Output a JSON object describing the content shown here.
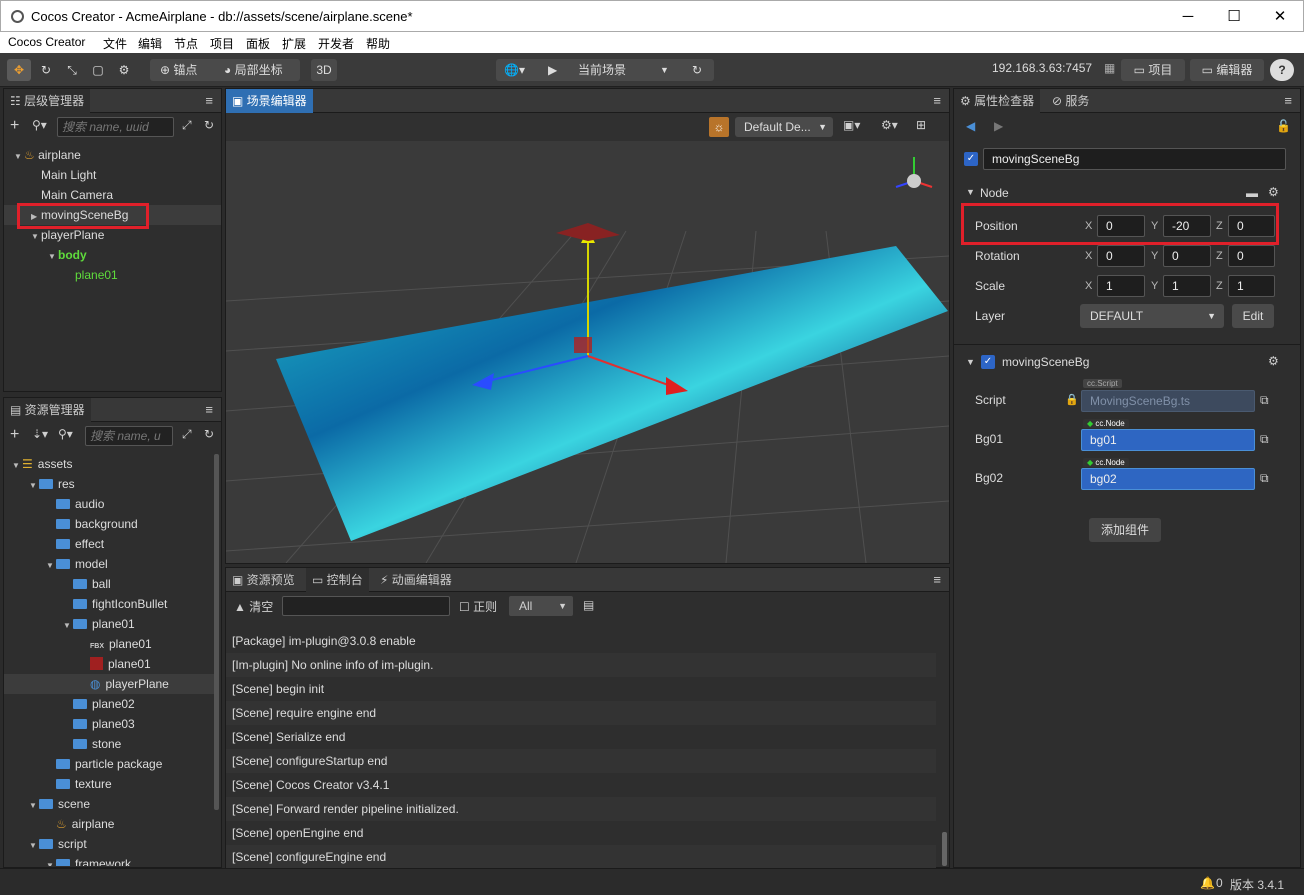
{
  "window": {
    "title": "Cocos Creator - AcmeAirplane - db://assets/scene/airplane.scene*",
    "minimize": "─",
    "maximize": "☐",
    "close": "✕"
  },
  "menu": [
    "Cocos Creator",
    "文件",
    "编辑",
    "节点",
    "项目",
    "面板",
    "扩展",
    "开发者",
    "帮助"
  ],
  "toolbar": {
    "anchor": "锚点",
    "local": "局部坐标",
    "mode3d": "3D",
    "scene_select": "当前场景",
    "ip": "192.168.3.63:7457",
    "project": "项目",
    "editor": "编辑器",
    "help": "?"
  },
  "hierarchy": {
    "tab": "层级管理器",
    "search_placeholder": "搜索 name, uuid",
    "nodes": [
      {
        "label": "airplane",
        "level": 0,
        "expanded": true,
        "icon": "scene"
      },
      {
        "label": "Main Light",
        "level": 1
      },
      {
        "label": "Main Camera",
        "level": 1
      },
      {
        "label": "movingSceneBg",
        "level": 1,
        "collapsed": true,
        "selected": true
      },
      {
        "label": "playerPlane",
        "level": 1,
        "expanded": true
      },
      {
        "label": "body",
        "level": 2,
        "expanded": true,
        "green": true
      },
      {
        "label": "plane01",
        "level": 3,
        "green": true
      }
    ]
  },
  "assets": {
    "tab": "资源管理器",
    "search_placeholder": "搜索 name, u",
    "items": [
      {
        "label": "assets",
        "level": 0,
        "expanded": true,
        "icon": "db"
      },
      {
        "label": "res",
        "level": 1,
        "expanded": true
      },
      {
        "label": "audio",
        "level": 2
      },
      {
        "label": "background",
        "level": 2
      },
      {
        "label": "effect",
        "level": 2
      },
      {
        "label": "model",
        "level": 2,
        "expanded": true
      },
      {
        "label": "ball",
        "level": 3
      },
      {
        "label": "fightIconBullet",
        "level": 3
      },
      {
        "label": "plane01",
        "level": 3,
        "expanded": true
      },
      {
        "label": "plane01",
        "level": 4,
        "icon": "fbx"
      },
      {
        "label": "plane01",
        "level": 4,
        "icon": "tex"
      },
      {
        "label": "playerPlane",
        "level": 4,
        "icon": "prefab",
        "selected": true
      },
      {
        "label": "plane02",
        "level": 3
      },
      {
        "label": "plane03",
        "level": 3
      },
      {
        "label": "stone",
        "level": 3
      },
      {
        "label": "particle package",
        "level": 2
      },
      {
        "label": "texture",
        "level": 2
      },
      {
        "label": "scene",
        "level": 1,
        "expanded": true
      },
      {
        "label": "airplane",
        "level": 2,
        "icon": "scene"
      },
      {
        "label": "script",
        "level": 1,
        "expanded": true
      },
      {
        "label": "framework",
        "level": 2,
        "expanded": true
      }
    ]
  },
  "scene_editor": {
    "tab": "场景编辑器",
    "camera_select": "Default De..."
  },
  "bottom_panel": {
    "tabs": [
      "资源预览",
      "控制台",
      "动画编辑器"
    ],
    "clear": "清空",
    "regex": "正则",
    "filter": "All",
    "logs": [
      "[Package] im-plugin@3.0.8 enable",
      "[Im-plugin] No online info of im-plugin.",
      "[Scene] begin init",
      "[Scene] require engine end",
      "[Scene] Serialize end",
      "[Scene] configureStartup end",
      "[Scene] Cocos Creator v3.4.1",
      "[Scene] Forward render pipeline initialized.",
      "[Scene] openEngine end",
      "[Scene] configureEngine end"
    ]
  },
  "inspector": {
    "tabs": [
      "属性检查器",
      "服务"
    ],
    "node_name": "movingSceneBg",
    "node_section": "Node",
    "position": {
      "label": "Position",
      "x": "0",
      "y": "-20",
      "z": "0"
    },
    "rotation": {
      "label": "Rotation",
      "x": "0",
      "y": "0",
      "z": "0"
    },
    "scale": {
      "label": "Scale",
      "x": "1",
      "y": "1",
      "z": "1"
    },
    "layer": {
      "label": "Layer",
      "value": "DEFAULT",
      "edit": "Edit"
    },
    "axes": {
      "x": "X",
      "y": "Y",
      "z": "Z"
    },
    "component": {
      "name": "movingSceneBg",
      "script": {
        "label": "Script",
        "tag": "cc.Script",
        "value": "MovingSceneBg.ts"
      },
      "bg01": {
        "label": "Bg01",
        "tag": "cc.Node",
        "value": "bg01"
      },
      "bg02": {
        "label": "Bg02",
        "tag": "cc.Node",
        "value": "bg02"
      }
    },
    "add_component": "添加组件"
  },
  "status": {
    "count": "0",
    "version": "版本 3.4.1"
  }
}
